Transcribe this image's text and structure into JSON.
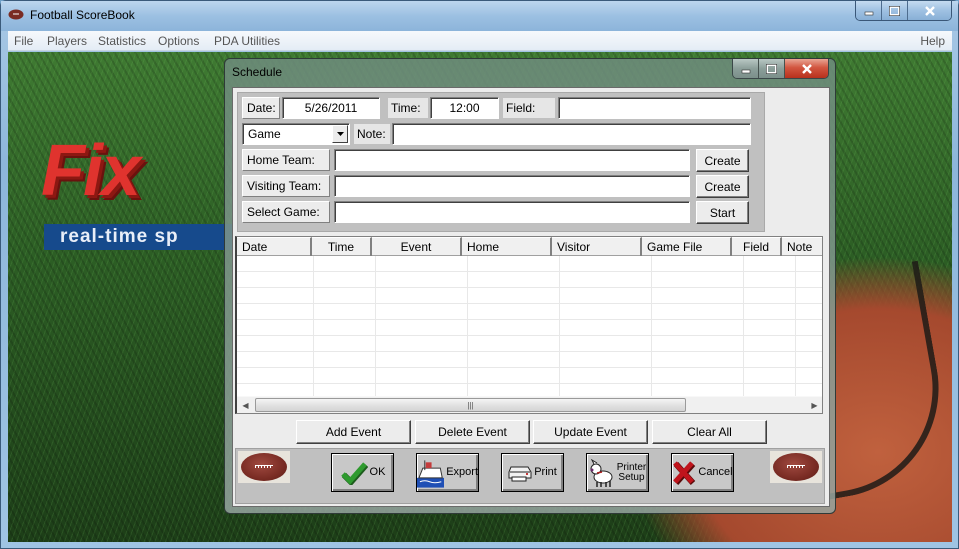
{
  "app": {
    "title": "Football ScoreBook",
    "icon": "football-icon",
    "caption": {
      "minimize": "minimize-icon",
      "maximize": "maximize-icon",
      "close": "close-icon"
    }
  },
  "menu": {
    "items": [
      "File",
      "Players",
      "Statistics",
      "Options",
      "PDA Utilities"
    ],
    "help": "Help"
  },
  "background": {
    "logo_text": "Fix",
    "logo_tagline": "real-time sp"
  },
  "dialog": {
    "title": "Schedule",
    "form": {
      "date_label": "Date:",
      "date_value": "5/26/2011",
      "time_label": "Time:",
      "time_value": "12:00",
      "field_label": "Field:",
      "field_value": "",
      "event_type": "Game",
      "note_label": "Note:",
      "note_value": "",
      "home_team_label": "Home Team:",
      "home_team_value": "",
      "home_create": "Create",
      "visiting_team_label": "Visiting Team:",
      "visiting_team_value": "",
      "visiting_create": "Create",
      "select_game_label": "Select Game:",
      "select_game_value": "",
      "start": "Start"
    },
    "grid": {
      "columns": [
        "Date",
        "Time",
        "Event",
        "Home",
        "Visitor",
        "Game File",
        "Field",
        "Note"
      ],
      "rows": []
    },
    "event_buttons": {
      "add": "Add Event",
      "delete": "Delete Event",
      "update": "Update Event",
      "clear": "Clear All"
    },
    "bottom_buttons": {
      "ok": "OK",
      "export": "Export",
      "print": "Print",
      "printer_setup_1": "Printer",
      "printer_setup_2": "Setup",
      "cancel": "Cancel"
    },
    "colors": {
      "ok_check": "#2e9a2e",
      "cancel_x": "#c0141c",
      "close_button": "#c8402a"
    }
  }
}
